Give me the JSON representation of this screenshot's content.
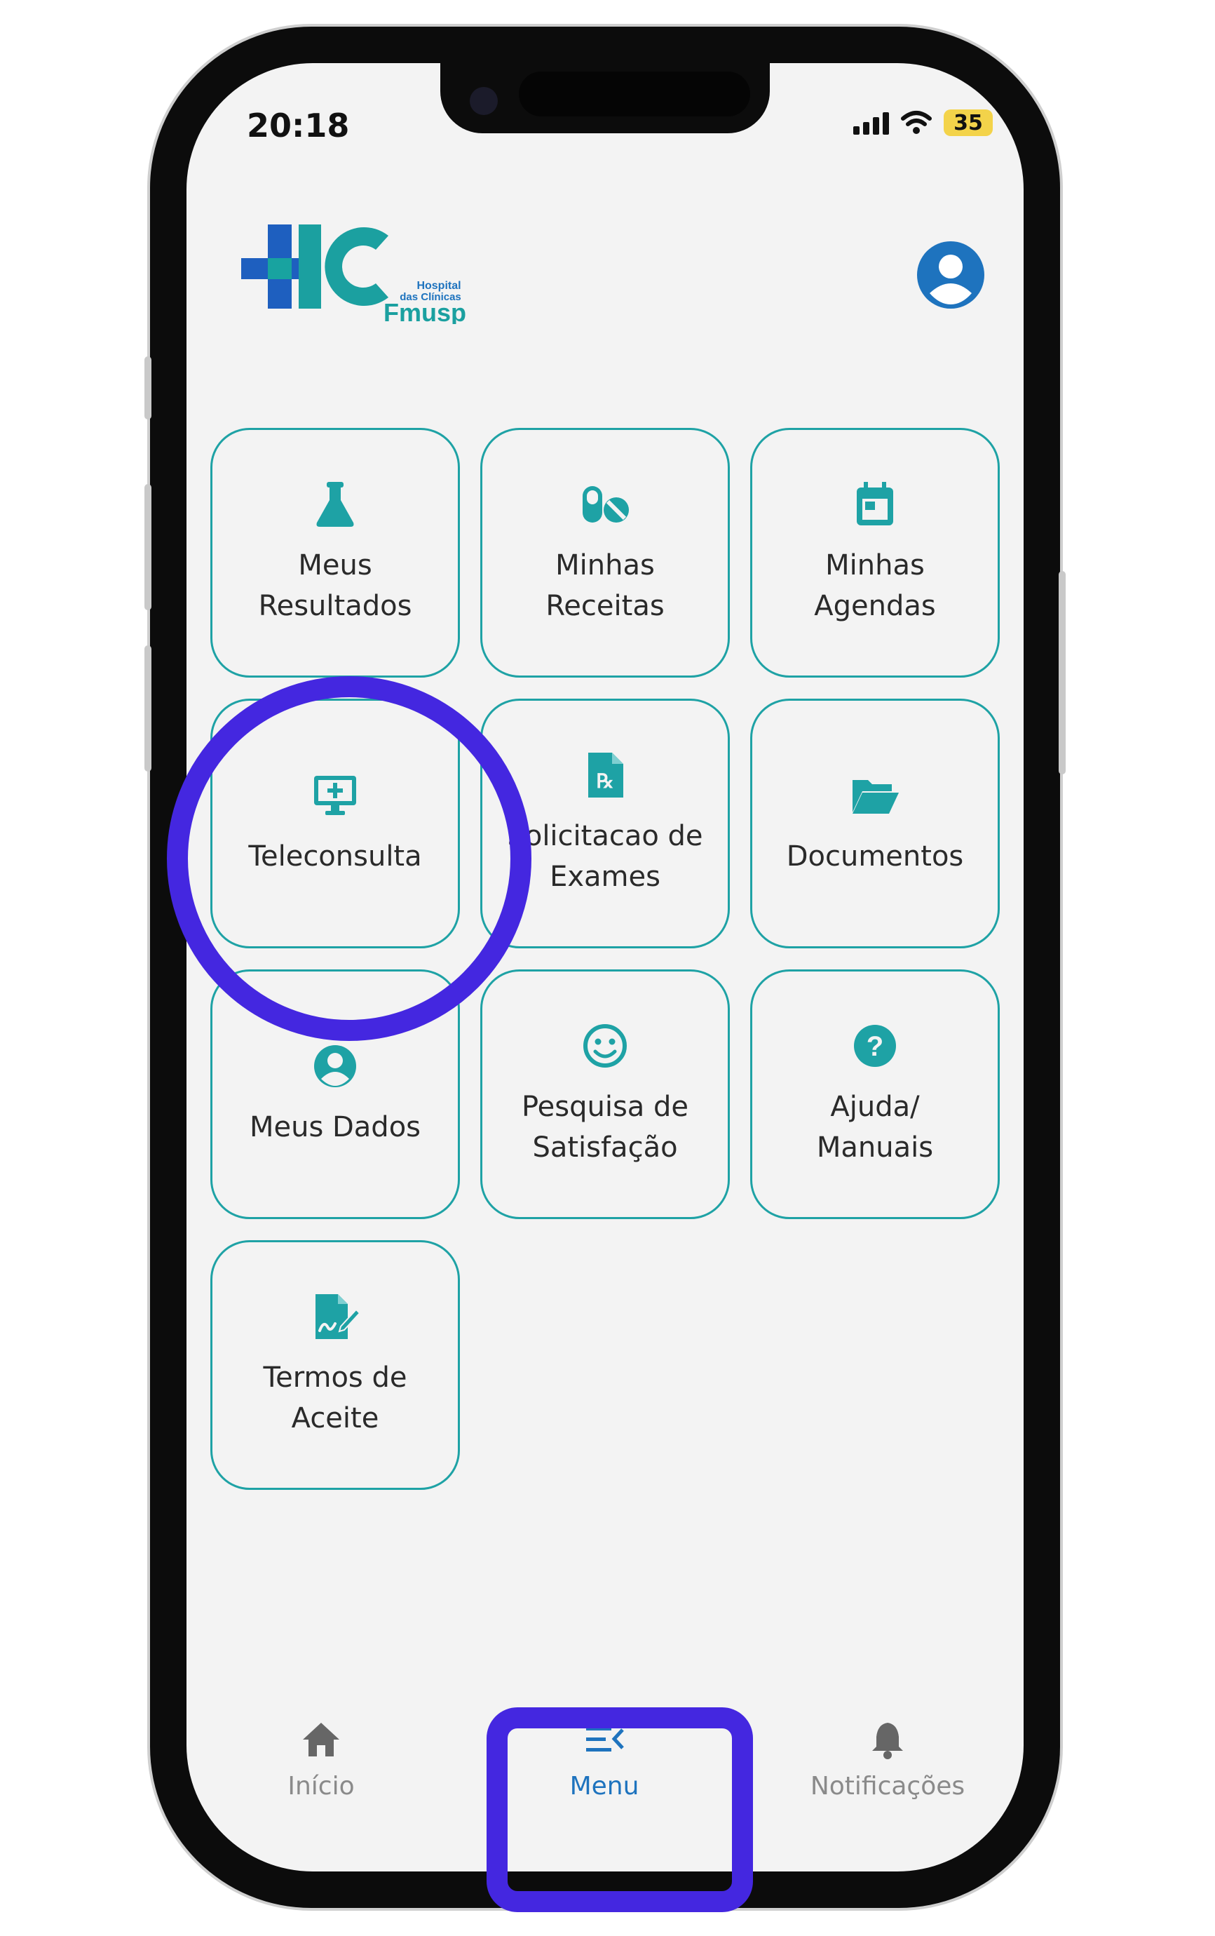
{
  "status_bar": {
    "time": "20:18",
    "battery": "35"
  },
  "header": {
    "logo": {
      "line1": "Hospital",
      "line2": "das Clínicas",
      "line3": "Fmusp"
    },
    "profile_icon": "account-circle-icon"
  },
  "menu": {
    "tiles": [
      {
        "icon": "flask-icon",
        "label": "Meus\nResultados"
      },
      {
        "icon": "pills-icon",
        "label": "Minhas\nReceitas"
      },
      {
        "icon": "calendar-icon",
        "label": "Minhas\nAgendas"
      },
      {
        "icon": "monitor-plus-icon",
        "label": "Teleconsulta"
      },
      {
        "icon": "prescription-file-icon",
        "label": "Solicitacao de\nExames"
      },
      {
        "icon": "folder-open-icon",
        "label": "Documentos"
      },
      {
        "icon": "account-circle-icon",
        "label": "Meus Dados"
      },
      {
        "icon": "smiley-icon",
        "label": "Pesquisa de\nSatisfação"
      },
      {
        "icon": "help-circle-icon",
        "label": "Ajuda/\nManuais"
      },
      {
        "icon": "signature-document-icon",
        "label": "Termos de\nAceite"
      }
    ]
  },
  "bottom_nav": {
    "items": [
      {
        "icon": "home-icon",
        "label": "Início",
        "active": false
      },
      {
        "icon": "menu-open-icon",
        "label": "Menu",
        "active": true
      },
      {
        "icon": "bell-icon",
        "label": "Notificações",
        "active": false
      }
    ]
  },
  "colors": {
    "teal": "#1ea2a5",
    "blue": "#1e73be",
    "annotation": "#4427e0",
    "inactive_nav": "#8a8a8a"
  }
}
